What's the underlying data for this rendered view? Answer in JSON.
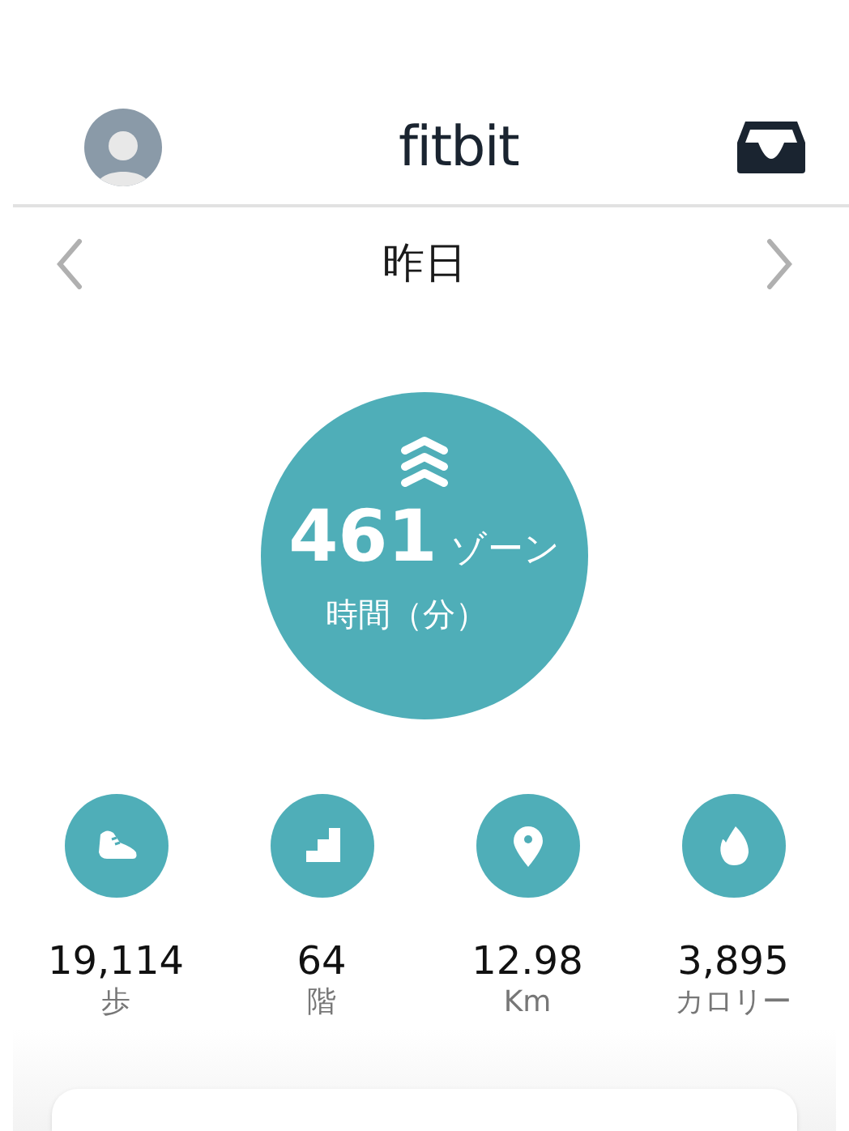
{
  "header": {
    "title": "fitbit"
  },
  "date_nav": {
    "label": "昨日"
  },
  "zone": {
    "value": "461",
    "unit": "ゾーン",
    "caption": "時間（分）"
  },
  "stats": [
    {
      "kind": "steps",
      "value": "19,114",
      "label": "歩"
    },
    {
      "kind": "floors",
      "value": "64",
      "label": "階"
    },
    {
      "kind": "distance",
      "value": "12.98",
      "label": "Km"
    },
    {
      "kind": "calories",
      "value": "3,895",
      "label": "カロリー"
    }
  ]
}
